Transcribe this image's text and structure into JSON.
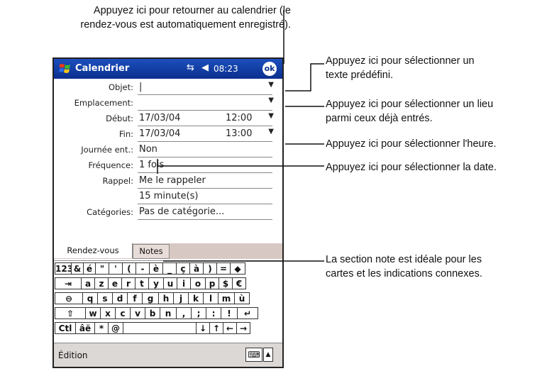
{
  "annotations": {
    "top_line1": "Appuyez ici pour retourner au calendrier (le",
    "top_line2": "rendez-vous est automatiquement enregistré).",
    "a1_line1": "Appuyez ici pour sélectionner un",
    "a1_line2": "texte prédéfini.",
    "a2_line1": "Appuyez ici pour sélectionner un lieu",
    "a2_line2": "parmi ceux déjà entrés.",
    "a3": "Appuyez ici pour sélectionner l'heure.",
    "a4": "Appuyez ici pour sélectionner la date.",
    "a5_line1": "La section note est idéale pour les",
    "a5_line2": "cartes et les indications connexes."
  },
  "titlebar": {
    "title": "Calendrier",
    "time": "08:23",
    "ok": "ok"
  },
  "form": {
    "objet_label": "Objet:",
    "objet_value": "|",
    "emplacement_label": "Emplacement:",
    "emplacement_value": "",
    "debut_label": "Début:",
    "debut_date": "17/03/04",
    "debut_time": "12:00",
    "fin_label": "Fin:",
    "fin_date": "17/03/04",
    "fin_time": "13:00",
    "journee_label": "Journée ent.:",
    "journee_value": "Non",
    "frequence_label": "Fréquence:",
    "frequence_value": "1 fois",
    "rappel_label": "Rappel:",
    "rappel_value": "Me le rappeler",
    "rappel_delay": "15  minute(s)",
    "categories_label": "Catégories:",
    "categories_value": "Pas de catégorie..."
  },
  "tabs": {
    "rdv": "Rendez-vous",
    "notes": "Notes"
  },
  "keyboard": {
    "row1": [
      "123",
      "&",
      "é",
      "\"",
      "'",
      "(",
      "-",
      "è",
      "_",
      "ç",
      "à",
      ")",
      "=",
      "◆"
    ],
    "row2": [
      "⇥",
      "a",
      "z",
      "e",
      "r",
      "t",
      "y",
      "u",
      "i",
      "o",
      "p",
      "$",
      "€"
    ],
    "row3": [
      "⊖",
      "q",
      "s",
      "d",
      "f",
      "g",
      "h",
      "j",
      "k",
      "l",
      "m",
      "ù"
    ],
    "row4": [
      "⇧",
      "w",
      "x",
      "c",
      "v",
      "b",
      "n",
      ",",
      ";",
      ":",
      "!",
      "↵"
    ],
    "row5": [
      "Ctl",
      "âë",
      "*",
      "@",
      " ",
      "↓",
      "↑",
      "←",
      "→"
    ]
  },
  "bottombar": {
    "menu": "Édition"
  }
}
